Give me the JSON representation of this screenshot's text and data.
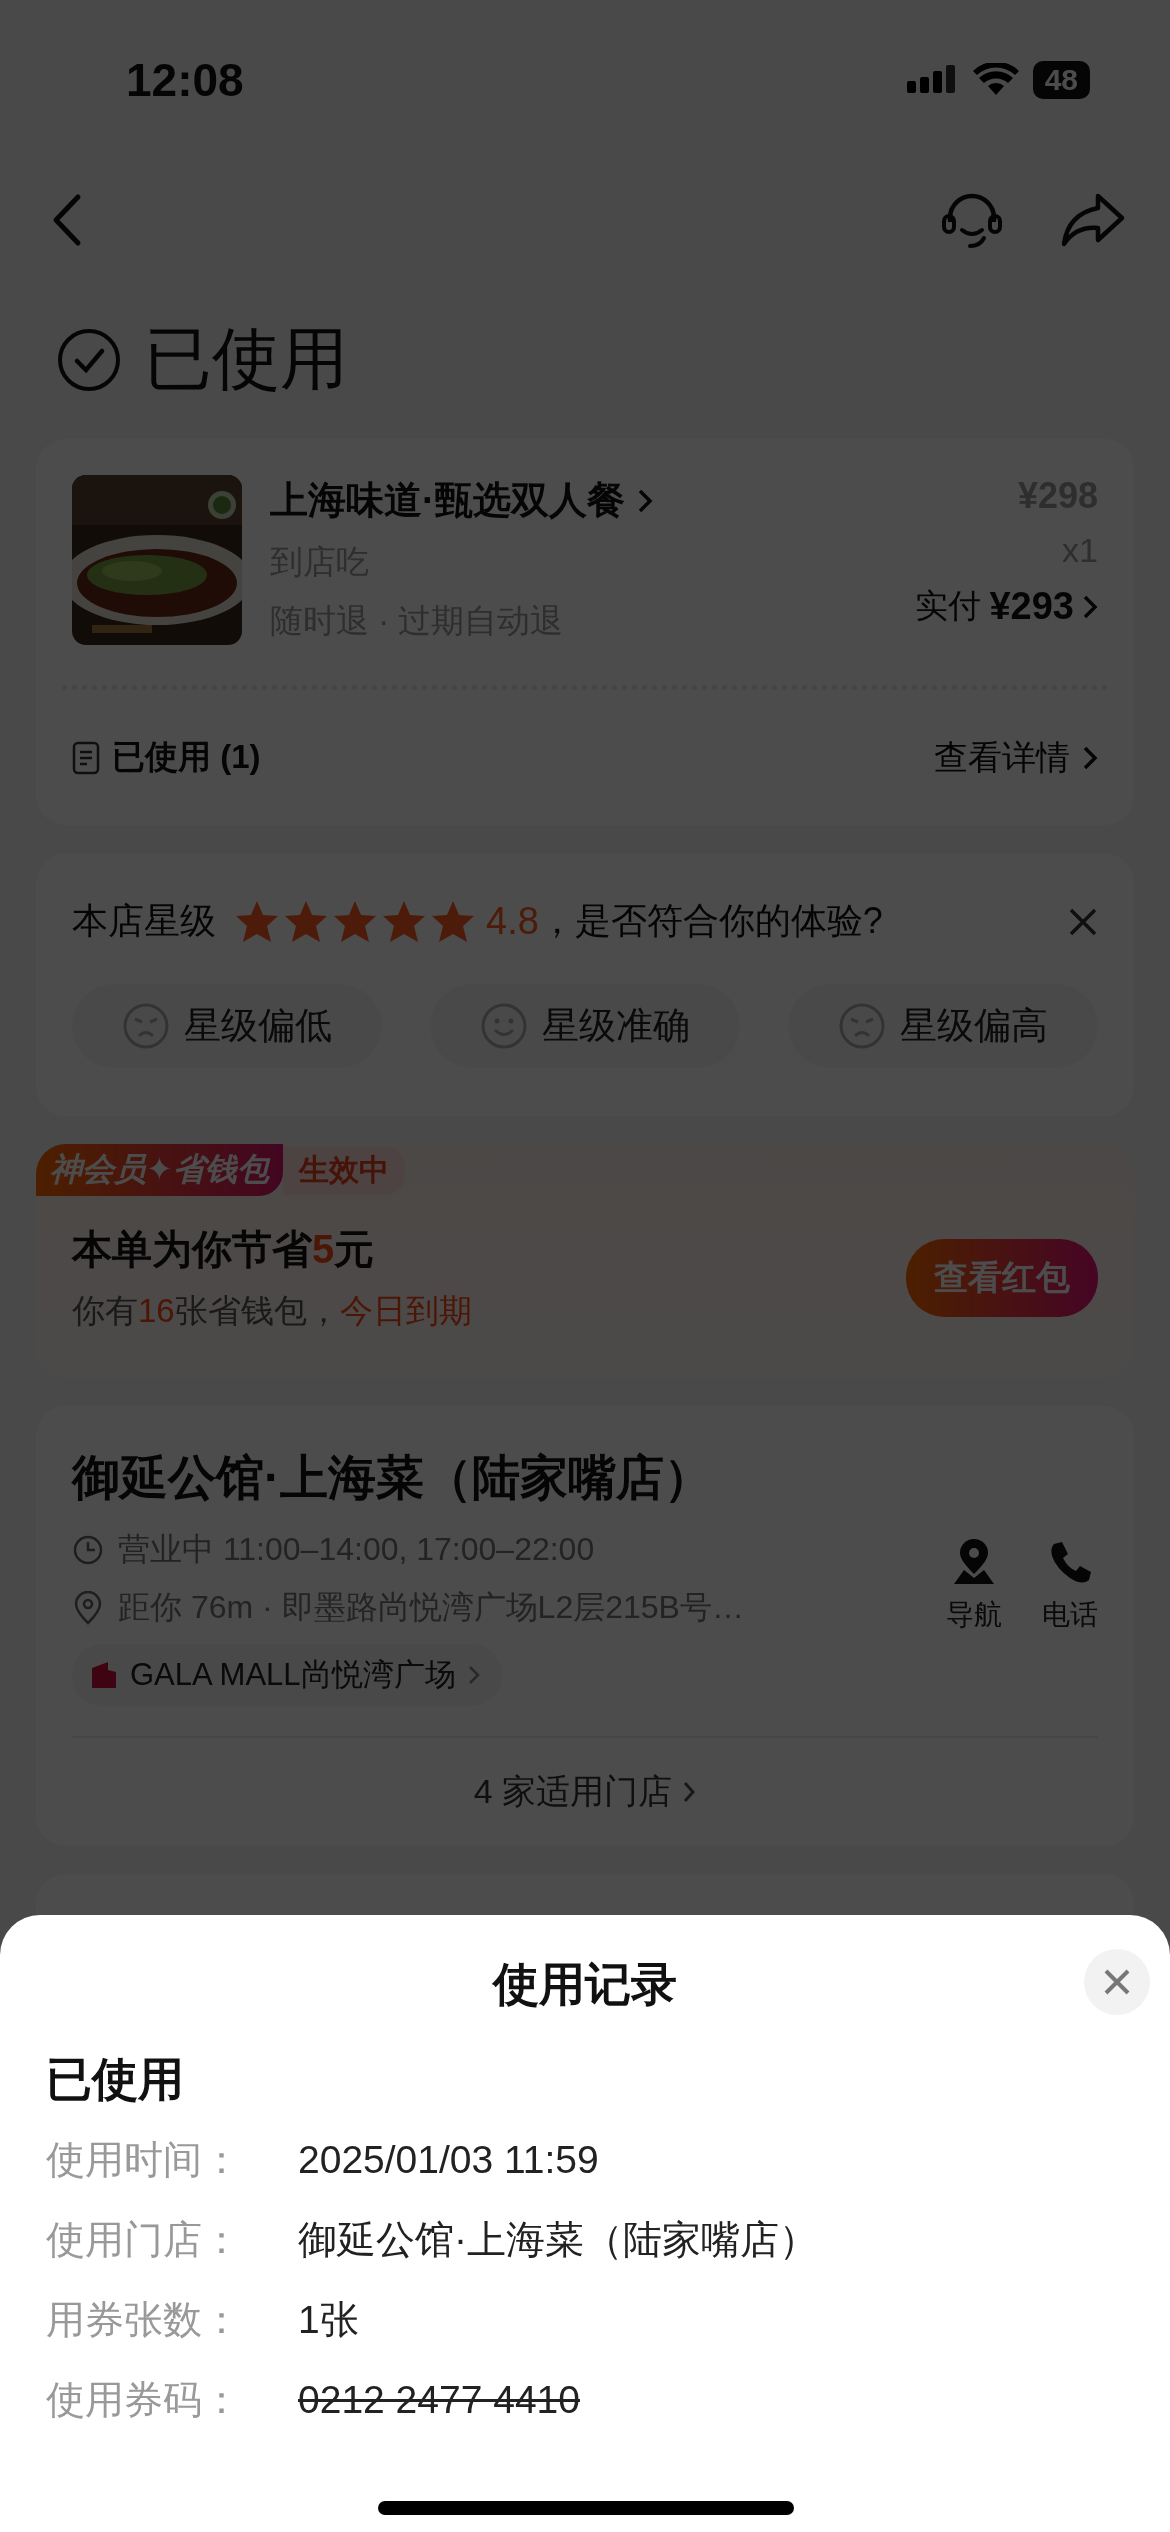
{
  "status_bar": {
    "time": "12:08",
    "battery": "48"
  },
  "header": {
    "title": "已使用"
  },
  "order": {
    "name": "上海味道·甄选双人餐",
    "type": "到店吃",
    "policy": "随时退 · 过期自动退",
    "price": "¥298",
    "quantity": "x1",
    "paid_label": "实付",
    "paid_amount": "¥293",
    "used": "已使用 (1)",
    "details": "查看详情"
  },
  "rating": {
    "label": "本店星级",
    "stars": 5,
    "score": "4.8",
    "question": "，是否符合你的体验?",
    "options": [
      {
        "label": "星级偏低",
        "kind": "low"
      },
      {
        "label": "星级准确",
        "kind": "ok"
      },
      {
        "label": "星级偏高",
        "kind": "high"
      }
    ]
  },
  "wallet": {
    "badge": "神会员✦省钱包",
    "status": "生效中",
    "saving_prefix": "本单为你节省",
    "saving_amount": "5",
    "saving_suffix": "元",
    "count_prefix": "你有",
    "count": "16",
    "count_suffix": "张省钱包，",
    "expiry": "今日到期",
    "button": "查看红包"
  },
  "store": {
    "name": "御延公馆·上海菜（陆家嘴店）",
    "hours": "营业中 11:00–14:00, 17:00–22:00",
    "address": "距你 76m · 即墨路尚悦湾广场L2层215B号…",
    "mall": "GALA MALL尚悦湾广场",
    "actions": [
      {
        "label": "导航",
        "kind": "navigate"
      },
      {
        "label": "电话",
        "kind": "phone"
      }
    ],
    "stores_link": "4 家适用门店"
  },
  "sheet": {
    "title": "使用记录",
    "status": "已使用",
    "rows": [
      {
        "label": "使用时间：",
        "value": "2025/01/03 11:59",
        "struck": false
      },
      {
        "label": "使用门店：",
        "value": "御延公馆·上海菜（陆家嘴店）",
        "struck": false
      },
      {
        "label": "用券张数：",
        "value": "1张",
        "struck": false
      },
      {
        "label": "使用券码：",
        "value": "0212 2477 4410",
        "struck": true
      }
    ]
  }
}
